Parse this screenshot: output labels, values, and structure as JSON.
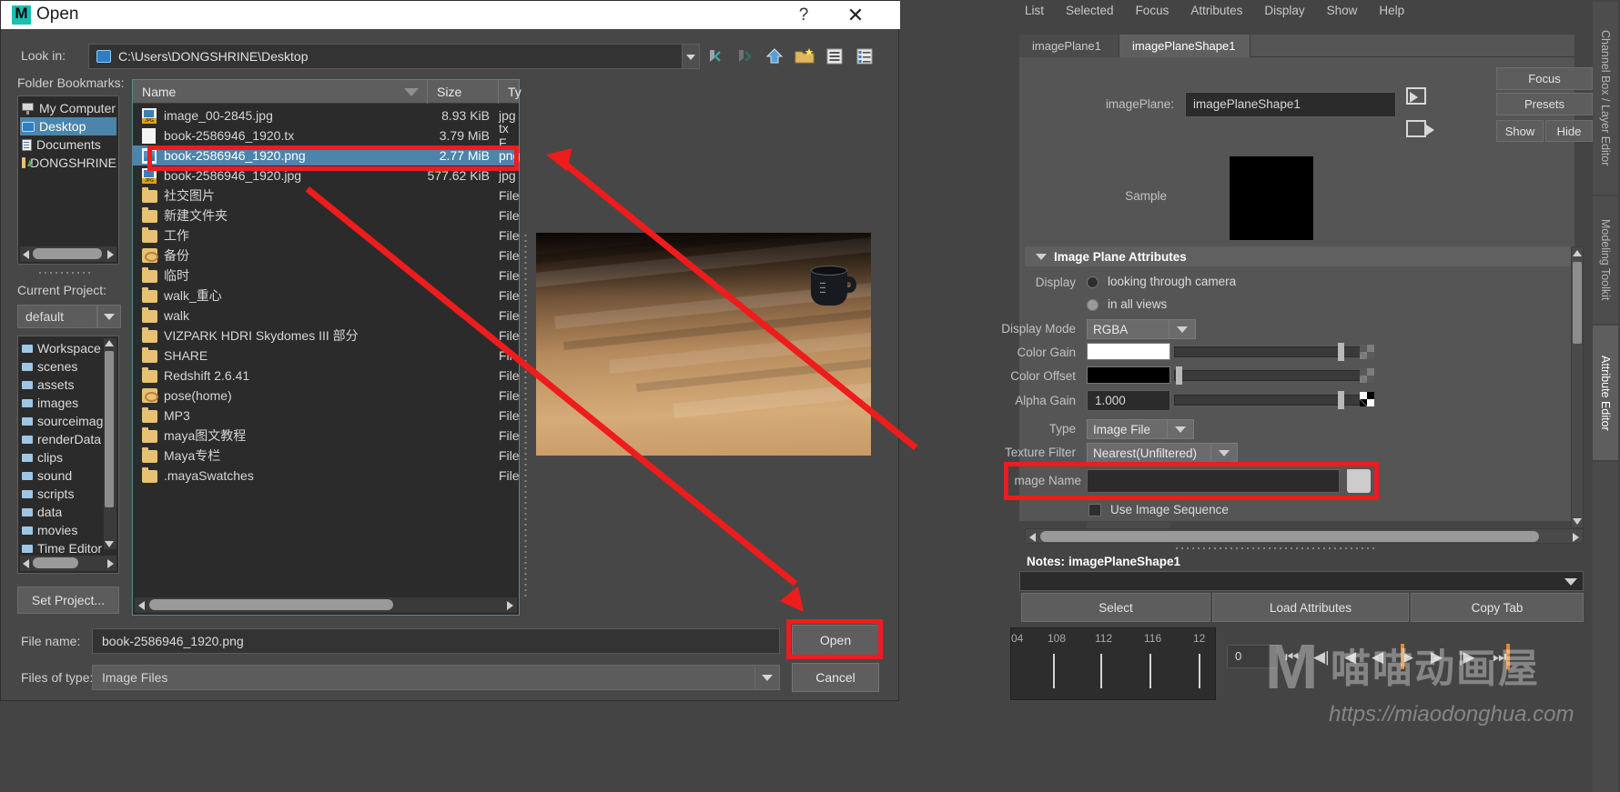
{
  "dialog": {
    "title": "Open",
    "help_label": "?",
    "close_label": "✕",
    "look_in_label": "Look in:",
    "look_in_path": "C:\\Users\\DONGSHRINE\\Desktop",
    "folder_bookmarks_label": "Folder Bookmarks:",
    "current_project_label": "Current Project:",
    "current_project_value": "default",
    "set_project_label": "Set Project...",
    "file_name_label": "File name:",
    "file_name_value": "book-2586946_1920.png",
    "files_of_type_label": "Files of type:",
    "files_of_type_value": "Image Files",
    "open_label": "Open",
    "cancel_label": "Cancel",
    "toolbar": [
      {
        "name": "back-icon",
        "glyph": "◀"
      },
      {
        "name": "forward-icon",
        "glyph": "▶"
      },
      {
        "name": "parent-folder-icon",
        "glyph": "⬆"
      },
      {
        "name": "new-folder-icon",
        "glyph": "➕"
      },
      {
        "name": "list-view-icon",
        "glyph": "☰"
      },
      {
        "name": "detail-view-icon",
        "glyph": "☷"
      }
    ],
    "bookmarks": [
      {
        "label": "My Computer",
        "icon": "computer-icon",
        "selected": false
      },
      {
        "label": "Desktop",
        "icon": "desktop-icon",
        "selected": true
      },
      {
        "label": "Documents",
        "icon": "documents-icon",
        "selected": false
      },
      {
        "label": "DONGSHRINE",
        "icon": "user-folder-icon",
        "selected": false
      }
    ],
    "workspace": [
      {
        "label": "Workspace R"
      },
      {
        "label": "scenes"
      },
      {
        "label": "assets"
      },
      {
        "label": "images"
      },
      {
        "label": "sourceimage"
      },
      {
        "label": "renderData"
      },
      {
        "label": "clips"
      },
      {
        "label": "sound"
      },
      {
        "label": "scripts"
      },
      {
        "label": "data"
      },
      {
        "label": "movies"
      },
      {
        "label": "Time Editor"
      }
    ],
    "columns": [
      {
        "label": "Name"
      },
      {
        "label": "Size"
      },
      {
        "label": "Ty"
      }
    ],
    "files": [
      {
        "name": "image_00-2845.jpg",
        "size": "8.93 KiB",
        "type": "jpg",
        "icon": "jpg-file-icon",
        "selected": false
      },
      {
        "name": "book-2586946_1920.tx",
        "size": "3.79 MiB",
        "type": "tx F",
        "icon": "tx-file-icon",
        "selected": false
      },
      {
        "name": "book-2586946_1920.png",
        "size": "2.77 MiB",
        "type": "png",
        "icon": "png-file-icon",
        "selected": true
      },
      {
        "name": "book-2586946_1920.jpg",
        "size": "577.62 KiB",
        "type": "jpg",
        "icon": "jpg-file-icon",
        "selected": false
      },
      {
        "name": "社交图片",
        "size": "",
        "type": "File",
        "icon": "folder-icon",
        "selected": false
      },
      {
        "name": "新建文件夹",
        "size": "",
        "type": "File",
        "icon": "folder-icon",
        "selected": false
      },
      {
        "name": "工作",
        "size": "",
        "type": "File",
        "icon": "folder-icon",
        "selected": false
      },
      {
        "name": "备份",
        "size": "",
        "type": "File",
        "icon": "pose-folder-icon",
        "selected": false
      },
      {
        "name": "临时",
        "size": "",
        "type": "File",
        "icon": "folder-icon",
        "selected": false
      },
      {
        "name": "walk_重心",
        "size": "",
        "type": "File",
        "icon": "folder-icon",
        "selected": false
      },
      {
        "name": "walk",
        "size": "",
        "type": "File",
        "icon": "folder-icon",
        "selected": false
      },
      {
        "name": "VIZPARK HDRI Skydomes III 部分",
        "size": "",
        "type": "File",
        "icon": "folder-icon",
        "selected": false
      },
      {
        "name": "SHARE",
        "size": "",
        "type": "Fil",
        "icon": "folder-icon",
        "selected": false
      },
      {
        "name": "Redshift 2.6.41",
        "size": "",
        "type": "File",
        "icon": "folder-icon",
        "selected": false
      },
      {
        "name": "pose(home)",
        "size": "",
        "type": "File",
        "icon": "pose-folder-icon",
        "selected": false
      },
      {
        "name": "MP3",
        "size": "",
        "type": "File",
        "icon": "folder-icon",
        "selected": false
      },
      {
        "name": "maya图文教程",
        "size": "",
        "type": "File",
        "icon": "folder-icon",
        "selected": false
      },
      {
        "name": "Maya专栏",
        "size": "",
        "type": "File",
        "icon": "folder-icon",
        "selected": false
      },
      {
        "name": ".mayaSwatches",
        "size": "",
        "type": "File",
        "icon": "folder-icon",
        "selected": false
      }
    ]
  },
  "maya": {
    "menus": [
      "List",
      "Selected",
      "Focus",
      "Attributes",
      "Display",
      "Show",
      "Help"
    ],
    "tabs": [
      {
        "label": "imagePlane1",
        "active": false
      },
      {
        "label": "imagePlaneShape1",
        "active": true
      }
    ],
    "image_plane_label": "imagePlane:",
    "image_plane_value": "imagePlaneShape1",
    "focus_label": "Focus",
    "presets_label": "Presets",
    "show_label": "Show",
    "hide_label": "Hide",
    "sample_label": "Sample",
    "section_title": "Image Plane Attributes",
    "display_label": "Display",
    "display_opt_1": "looking through camera",
    "display_opt_2": "in all views",
    "display_mode_label": "Display Mode",
    "display_mode_value": "RGBA",
    "color_gain_label": "Color Gain",
    "color_offset_label": "Color Offset",
    "alpha_gain_label": "Alpha Gain",
    "alpha_gain_value": "1.000",
    "type_label": "Type",
    "type_value": "Image File",
    "texture_filter_label": "Texture Filter",
    "texture_filter_value": "Nearest(Unfiltered)",
    "image_name_label": "mage Name",
    "image_name_value": "",
    "use_image_sequence_label": "Use Image Sequence",
    "notes_label": "Notes:",
    "notes_value": "imagePlaneShape1",
    "select_label": "Select",
    "load_attributes_label": "Load Attributes",
    "copy_tab_label": "Copy Tab",
    "side_tabs": [
      {
        "label": "Channel Box / Layer Editor",
        "active": false
      },
      {
        "label": "Modeling Toolkit",
        "active": false
      },
      {
        "label": "Attribute Editor",
        "active": true
      }
    ],
    "colors": {
      "accent_blue": "#4c85ab",
      "annotation_red": "#ee1c1c",
      "maya_teal": "#18c0b4",
      "panel_gray": "#555555"
    }
  },
  "timeline": {
    "ticks": [
      "04",
      "108",
      "112",
      "116",
      "12"
    ],
    "current_frame": "0"
  },
  "watermark": {
    "letter": "M",
    "text_cn": "喵喵动画屋",
    "url": "https://miaodonghua.com"
  }
}
